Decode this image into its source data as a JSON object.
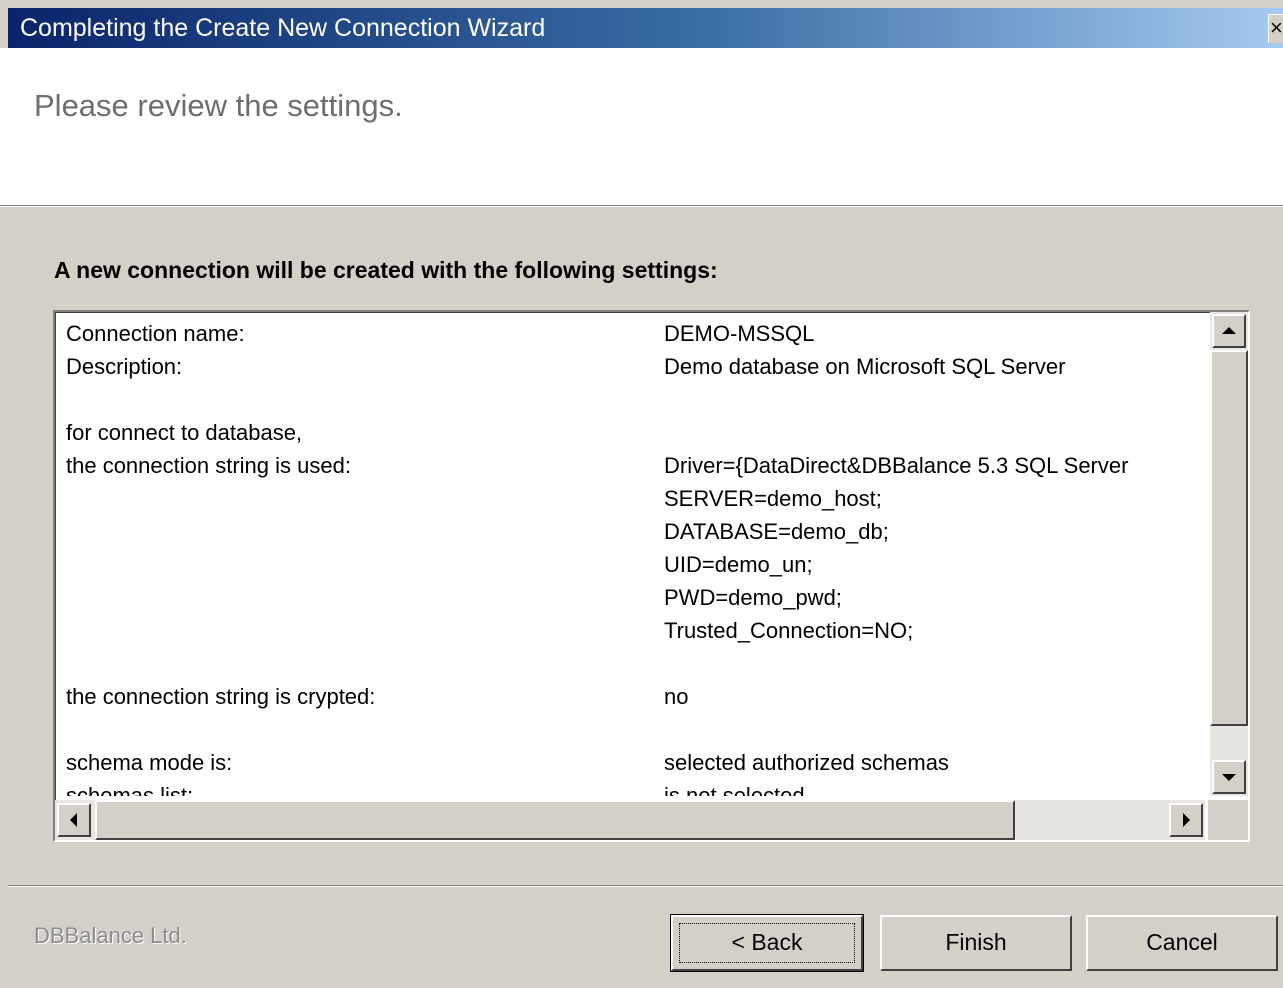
{
  "window": {
    "title": "Completing the Create New Connection Wizard",
    "close_glyph": "×"
  },
  "header": {
    "subtitle": "Please review the settings."
  },
  "content": {
    "heading": "A new connection will be created with the following settings:",
    "rows": [
      {
        "label": "Connection name:",
        "value": "DEMO-MSSQL"
      },
      {
        "label": "Description:",
        "value": "Demo database on Microsoft SQL Server"
      },
      {
        "label": "",
        "value": ""
      },
      {
        "label": "for connect to database,",
        "value": ""
      },
      {
        "label": "the connection string is used:",
        "value": "Driver={DataDirect&DBBalance 5.3 SQL Server"
      },
      {
        "label": "",
        "value": "SERVER=demo_host;"
      },
      {
        "label": "",
        "value": "DATABASE=demo_db;"
      },
      {
        "label": "",
        "value": "UID=demo_un;"
      },
      {
        "label": "",
        "value": "PWD=demo_pwd;"
      },
      {
        "label": "",
        "value": "Trusted_Connection=NO;"
      },
      {
        "label": "",
        "value": ""
      },
      {
        "label": "the connection string is crypted:",
        "value": "no"
      },
      {
        "label": "",
        "value": ""
      },
      {
        "label": "schema mode is:",
        "value": "selected authorized schemas"
      },
      {
        "label": "schemas list:",
        "value": "is not selected"
      }
    ]
  },
  "footer": {
    "company": "DBBalance Ltd.",
    "back_label": "< Back",
    "finish_label": "Finish",
    "cancel_label": "Cancel"
  },
  "icons": {
    "scroll_up": "up-arrow-icon",
    "scroll_down": "down-arrow-icon",
    "scroll_left": "left-arrow-icon",
    "scroll_right": "right-arrow-icon"
  },
  "colors": {
    "title_gradient_start": "#0a246a",
    "title_gradient_end": "#a6caf0",
    "dialog_face": "#d4d0c8"
  }
}
